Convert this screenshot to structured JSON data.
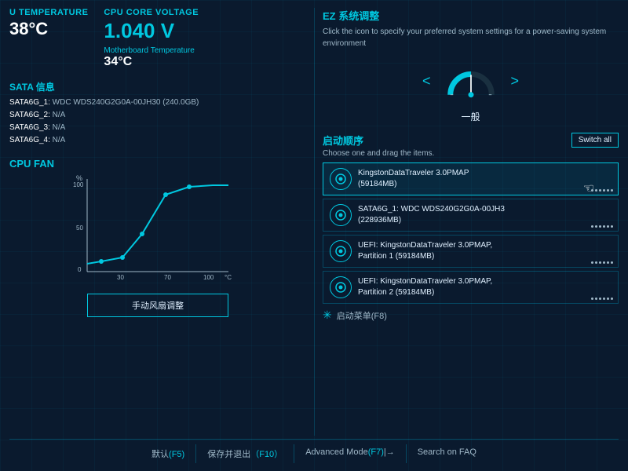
{
  "header": {
    "cpu_temp_label": "U Temperature",
    "cpu_temp_value": "38°C",
    "cpu_voltage_label": "CPU Core Voltage",
    "cpu_voltage_value": "1.040 V",
    "mb_temp_label": "Motherboard Temperature",
    "mb_temp_value": "34°C"
  },
  "sata": {
    "title": "SATA 信息",
    "items": [
      {
        "label": "SATA6G_1:",
        "value": "WDC WDS240G2G0A-00JH30 (240.0GB)"
      },
      {
        "label": "SATA6G_2:",
        "value": "N/A"
      },
      {
        "label": "SATA6G_3:",
        "value": "N/A"
      },
      {
        "label": "SATA6G_4:",
        "value": "N/A"
      }
    ]
  },
  "fan": {
    "title": "CPU FAN",
    "y_label": "%",
    "x_label": "°C",
    "y_ticks": [
      "100",
      "50",
      "0"
    ],
    "x_ticks": [
      "30",
      "70",
      "100"
    ],
    "button_label": "手动风扇调整"
  },
  "ez": {
    "title": "EZ 系统调整",
    "description": "Click the icon to specify your preferred system settings for a power-saving system environment",
    "mode_label": "一般",
    "prev_btn": "<",
    "next_btn": ">"
  },
  "boot": {
    "title": "启动顺序",
    "subtitle": "Choose one and drag the items.",
    "switch_all_label": "Switch all",
    "items": [
      {
        "name": "KingstonDataTraveler 3.0PMAP",
        "detail": "(59184MB)",
        "active": true
      },
      {
        "name": "SATA6G_1: WDC WDS240G2G0A-00JH3",
        "detail": "(228936MB)",
        "active": false
      },
      {
        "name": "UEFI: KingstonDataTraveler 3.0PMAP,",
        "detail": "Partition 1 (59184MB)",
        "active": false
      },
      {
        "name": "UEFI: KingstonDataTraveler 3.0PMAP,",
        "detail": "Partition 2 (59184MB)",
        "active": false
      }
    ],
    "menu_label": "启动菜单(F8)"
  },
  "footer": {
    "items": [
      {
        "key": "默认",
        "shortcut": "(F5)"
      },
      {
        "key": "保存并退出",
        "shortcut": "（F10）"
      },
      {
        "key": "Advanced Mode(F7)",
        "shortcut": "|→"
      },
      {
        "key": "Search on FAQ",
        "shortcut": ""
      }
    ]
  }
}
